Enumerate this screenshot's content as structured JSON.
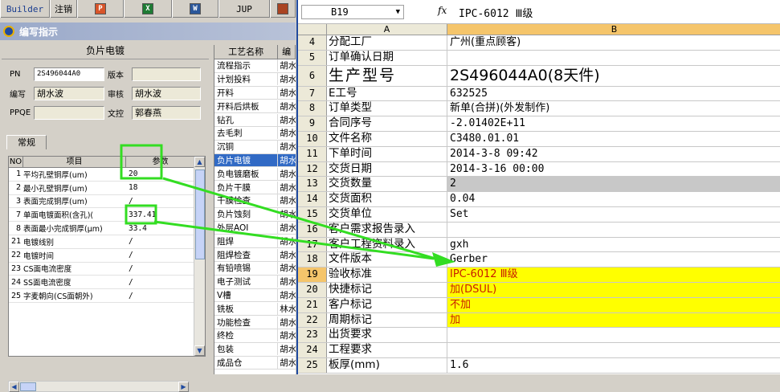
{
  "toolbar": {
    "builder": "Builder",
    "logout": "注销",
    "btn3": "",
    "btn4": "",
    "btn5": "",
    "jup": "JUP"
  },
  "dialog": {
    "title": "编写指示",
    "panel_title": "负片电镀",
    "pn_label": "PN",
    "pn_value": "2S496044A0",
    "version_label": "版本",
    "version_value": "",
    "author_label": "编写",
    "author_value": "胡水波",
    "reviewer_label": "审核",
    "reviewer_value": "胡水波",
    "ppqe_label": "PPQE",
    "ppqe_value": "",
    "control_label": "文控",
    "control_value": "郭春燕",
    "tab": "常规",
    "grid": {
      "headers": [
        "NO",
        "项目",
        "参数"
      ],
      "rows": [
        {
          "no": "1",
          "item": "平均孔壁铜厚(um)",
          "val": "20"
        },
        {
          "no": "2",
          "item": "最小孔壁铜厚(um)",
          "val": "18"
        },
        {
          "no": "3",
          "item": "表面完成铜厚(um)",
          "val": "/"
        },
        {
          "no": "7",
          "item": "单面电镀面积(含孔)(",
          "val": "337.41"
        },
        {
          "no": "8",
          "item": "表面最小完成铜厚(μm)",
          "val": "33.4"
        },
        {
          "no": "21",
          "item": "电镀线别",
          "val": "/"
        },
        {
          "no": "22",
          "item": "电镀时间",
          "val": "/"
        },
        {
          "no": "23",
          "item": "CS面电流密度",
          "val": "/"
        },
        {
          "no": "24",
          "item": "SS面电流密度",
          "val": "/"
        },
        {
          "no": "25",
          "item": "字麦朝向(CS面朝外)",
          "val": "/"
        }
      ]
    }
  },
  "process_list": {
    "headers": [
      "工艺名称",
      "编"
    ],
    "rows": [
      {
        "name": "流程指示",
        "who": "胡水"
      },
      {
        "name": "计划投料",
        "who": "胡水"
      },
      {
        "name": "开料",
        "who": "胡水"
      },
      {
        "name": "开料后烘板",
        "who": "胡水"
      },
      {
        "name": "钻孔",
        "who": "胡水"
      },
      {
        "name": "去毛刺",
        "who": "胡水"
      },
      {
        "name": "沉铜",
        "who": "胡水"
      },
      {
        "name": "负片电镀",
        "who": "胡水"
      },
      {
        "name": "负电镀磨板",
        "who": "胡水"
      },
      {
        "name": "负片干膜",
        "who": "胡水"
      },
      {
        "name": "干膜检查",
        "who": "胡水"
      },
      {
        "name": "负片蚀刻",
        "who": "胡水"
      },
      {
        "name": "外层AOI",
        "who": "胡水"
      },
      {
        "name": "阻焊",
        "who": "胡水"
      },
      {
        "name": "阻焊检查",
        "who": "胡水"
      },
      {
        "name": "有铅喷锡",
        "who": "胡水"
      },
      {
        "name": "电子测试",
        "who": "胡水"
      },
      {
        "name": "V槽",
        "who": "胡水"
      },
      {
        "name": "铣板",
        "who": "林水"
      },
      {
        "name": "功能检查",
        "who": "胡水"
      },
      {
        "name": "终检",
        "who": "胡水"
      },
      {
        "name": "包装",
        "who": "胡水"
      },
      {
        "name": "成品仓",
        "who": "胡水"
      }
    ]
  },
  "sheet": {
    "namebox": "B19",
    "fx": "fx",
    "formula_value": "IPC-6012 Ⅲ级",
    "col_a": "A",
    "col_b": "B",
    "rows": [
      {
        "rn": "4",
        "a": "分配工厂",
        "b": "广州(重点顾客)"
      },
      {
        "rn": "5",
        "a": "订单确认日期",
        "b": ""
      },
      {
        "rn": "6",
        "a": "生产型号",
        "b": "2S496044A0(8天件)"
      },
      {
        "rn": "7",
        "a": "E工号",
        "b": "632525"
      },
      {
        "rn": "8",
        "a": "订单类型",
        "b": "新单(合拼)(外发制作)"
      },
      {
        "rn": "9",
        "a": "合同序号",
        "b": "-2.01402E+11"
      },
      {
        "rn": "10",
        "a": "文件名称",
        "b": "C3480.01.01"
      },
      {
        "rn": "11",
        "a": "下单时间",
        "b": "2014-3-8 09:42"
      },
      {
        "rn": "12",
        "a": "交货日期",
        "b": "2014-3-16 00:00"
      },
      {
        "rn": "13",
        "a": "交货数量",
        "b": "2"
      },
      {
        "rn": "14",
        "a": "交货面积",
        "b": "0.04"
      },
      {
        "rn": "15",
        "a": "交货单位",
        "b": "Set"
      },
      {
        "rn": "16",
        "a": "客户需求报告录入",
        "b": ""
      },
      {
        "rn": "17",
        "a": "客户工程资料录入",
        "b": "gxh"
      },
      {
        "rn": "18",
        "a": "文件版本",
        "b": "Gerber"
      },
      {
        "rn": "19",
        "a": "验收标准",
        "b": "IPC-6012 Ⅲ级"
      },
      {
        "rn": "20",
        "a": "快捷标记",
        "b": "加(DSUL)"
      },
      {
        "rn": "21",
        "a": "客户标记",
        "b": "不加"
      },
      {
        "rn": "22",
        "a": "周期标记",
        "b": "加"
      },
      {
        "rn": "23",
        "a": "出货要求",
        "b": ""
      },
      {
        "rn": "24",
        "a": "工程要求",
        "b": ""
      },
      {
        "rn": "25",
        "a": "板厚(mm)",
        "b": "1.6"
      }
    ]
  },
  "colors": {
    "highlight_box": "#33dd22",
    "yellow_cell": "#ffff00",
    "red_text": "#c81c00",
    "selected_blue": "#316ac5",
    "column_header_selected": "#f5c56b"
  }
}
